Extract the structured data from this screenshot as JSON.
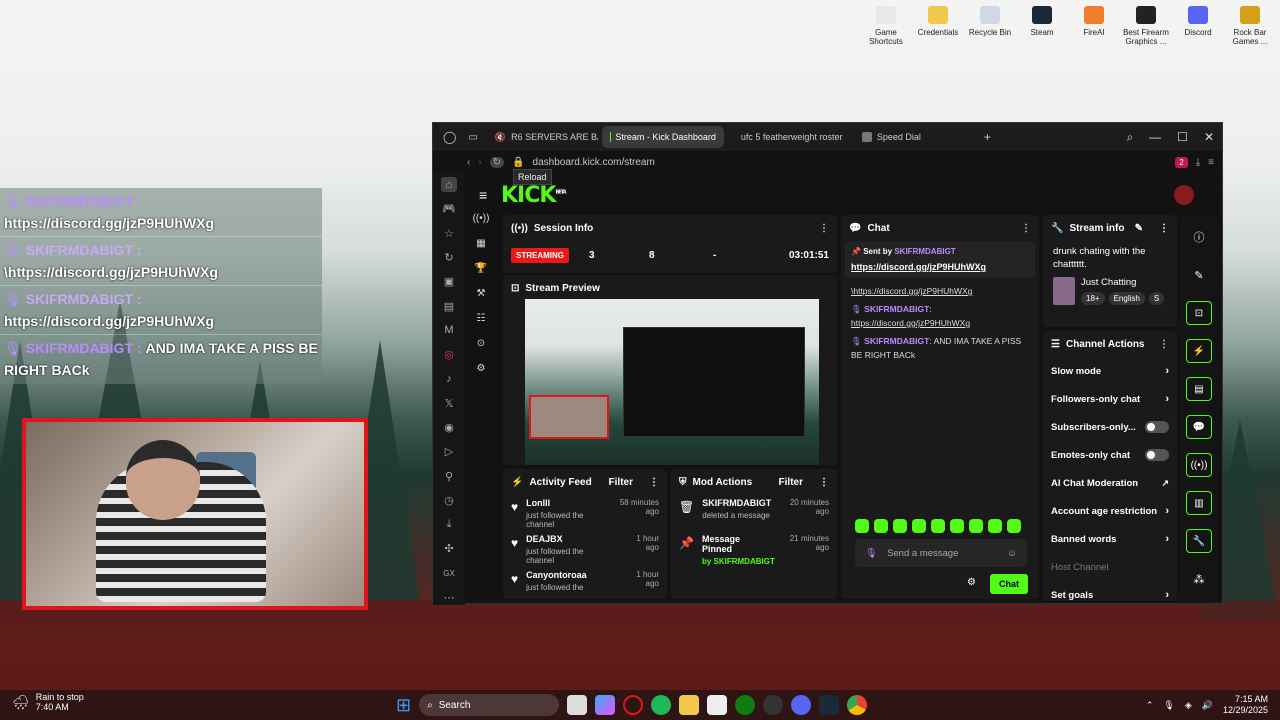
{
  "desktop_icons": [
    {
      "label": "Game Shortcuts",
      "color": "#e8e8e8"
    },
    {
      "label": "Credentials",
      "color": "#f2c94c"
    },
    {
      "label": "Recycle Bin",
      "color": "#cfd8e3"
    },
    {
      "label": "Steam",
      "color": "#1b2838"
    },
    {
      "label": "FireAI",
      "color": "#f07d2a"
    },
    {
      "label": "Best Firearm Graphics ...",
      "color": "#222222"
    },
    {
      "label": "Discord",
      "color": "#5865f2"
    },
    {
      "label": "Rock Bar Games ...",
      "color": "#d4a017"
    }
  ],
  "overlay": {
    "messages": [
      {
        "user": "SKIFRMDABIGT :",
        "text": "https://discord.gg/jzP9HUhWXg"
      },
      {
        "user": "SKIFRMDABIGT :",
        "text": "\\https://discord.gg/jzP9HUhWXg"
      },
      {
        "user": "SKIFRMDABIGT :",
        "text": "https://discord.gg/jzP9HUhWXg"
      },
      {
        "user": "SKIFRMDABIGT :",
        "text": "AND IMA TAKE A PISS BE RIGHT BACk"
      }
    ]
  },
  "browser": {
    "tabs": [
      {
        "label": "R6 SERVERS ARE BACK",
        "color": "#e62117",
        "active": false
      },
      {
        "label": "Stream - Kick Dashboard",
        "color": "#53fc18",
        "active": true
      },
      {
        "label": "ufc 5 featherweight roster",
        "color": "#4285f4",
        "active": false
      },
      {
        "label": "Speed Dial",
        "color": "#888888",
        "active": false
      }
    ],
    "url": "dashboard.kick.com/stream",
    "tooltip": "Reload",
    "badge_count": "2"
  },
  "kick": {
    "logo": "KICK",
    "logo_tag": "BETA",
    "session": {
      "title": "Session Info",
      "status": "STREAMING",
      "viewers": "3",
      "followers": "8",
      "subs": "-",
      "duration": "03:01:51"
    },
    "preview_title": "Stream Preview",
    "activity": {
      "title": "Activity Feed",
      "filter": "Filter",
      "items": [
        {
          "name": "Lonlll",
          "sub": "just followed the channel",
          "time": "58 minutes ago"
        },
        {
          "name": "DEAJBX",
          "sub": "just followed the channel",
          "time": "1 hour ago"
        },
        {
          "name": "Canyontoroaa",
          "sub": "just followed the channel",
          "time": "1 hour ago"
        }
      ]
    },
    "mod": {
      "title": "Mod Actions",
      "filter": "Filter",
      "items": [
        {
          "name": "SKIFRMDABIGT",
          "sub": "deleted a message",
          "time": "20 minutes ago"
        },
        {
          "name": "Message Pinned",
          "sub": "by SKIFRMDABIGT",
          "time": "21 minutes ago"
        }
      ]
    },
    "chat": {
      "title": "Chat",
      "pinned_by": "Sent by",
      "pinned_user": "SKIFRMDABIGT",
      "pinned_link": "https://discord.gg/jzP9HUhWXg",
      "messages": [
        {
          "user": "",
          "text": "\\https://discord.gg/jzP9HUhWXg"
        },
        {
          "user": "SKIFRMDABIGT",
          "text": "https://discord.gg/jzP9HUhWXg"
        },
        {
          "user": "SKIFRMDABIGT",
          "text": "AND IMA TAKE A PISS BE RIGHT BACk"
        }
      ],
      "placeholder": "Send a message",
      "send": "Chat"
    },
    "stream_info": {
      "title": "Stream info",
      "stream_title": "drunk chating with the chatttttt.",
      "category": "Just Chatting",
      "tags": [
        "18+",
        "English",
        "S"
      ]
    },
    "channel_actions": {
      "title": "Channel Actions",
      "items": [
        {
          "label": "Slow mode",
          "kind": "chev"
        },
        {
          "label": "Followers-only chat",
          "kind": "chev"
        },
        {
          "label": "Subscribers-only...",
          "kind": "toggle"
        },
        {
          "label": "Emotes-only chat",
          "kind": "toggle"
        },
        {
          "label": "AI Chat Moderation",
          "kind": "ext"
        },
        {
          "label": "Account age restriction",
          "kind": "chev"
        },
        {
          "label": "Banned words",
          "kind": "chev"
        },
        {
          "label": "Host Channel",
          "kind": "none"
        },
        {
          "label": "Set goals",
          "kind": "chev"
        }
      ]
    }
  },
  "taskbar": {
    "weather_title": "Rain to stop",
    "weather_time": "7:40 AM",
    "search": "Search",
    "time": "7:15 AM",
    "date": "12/29/2025"
  }
}
